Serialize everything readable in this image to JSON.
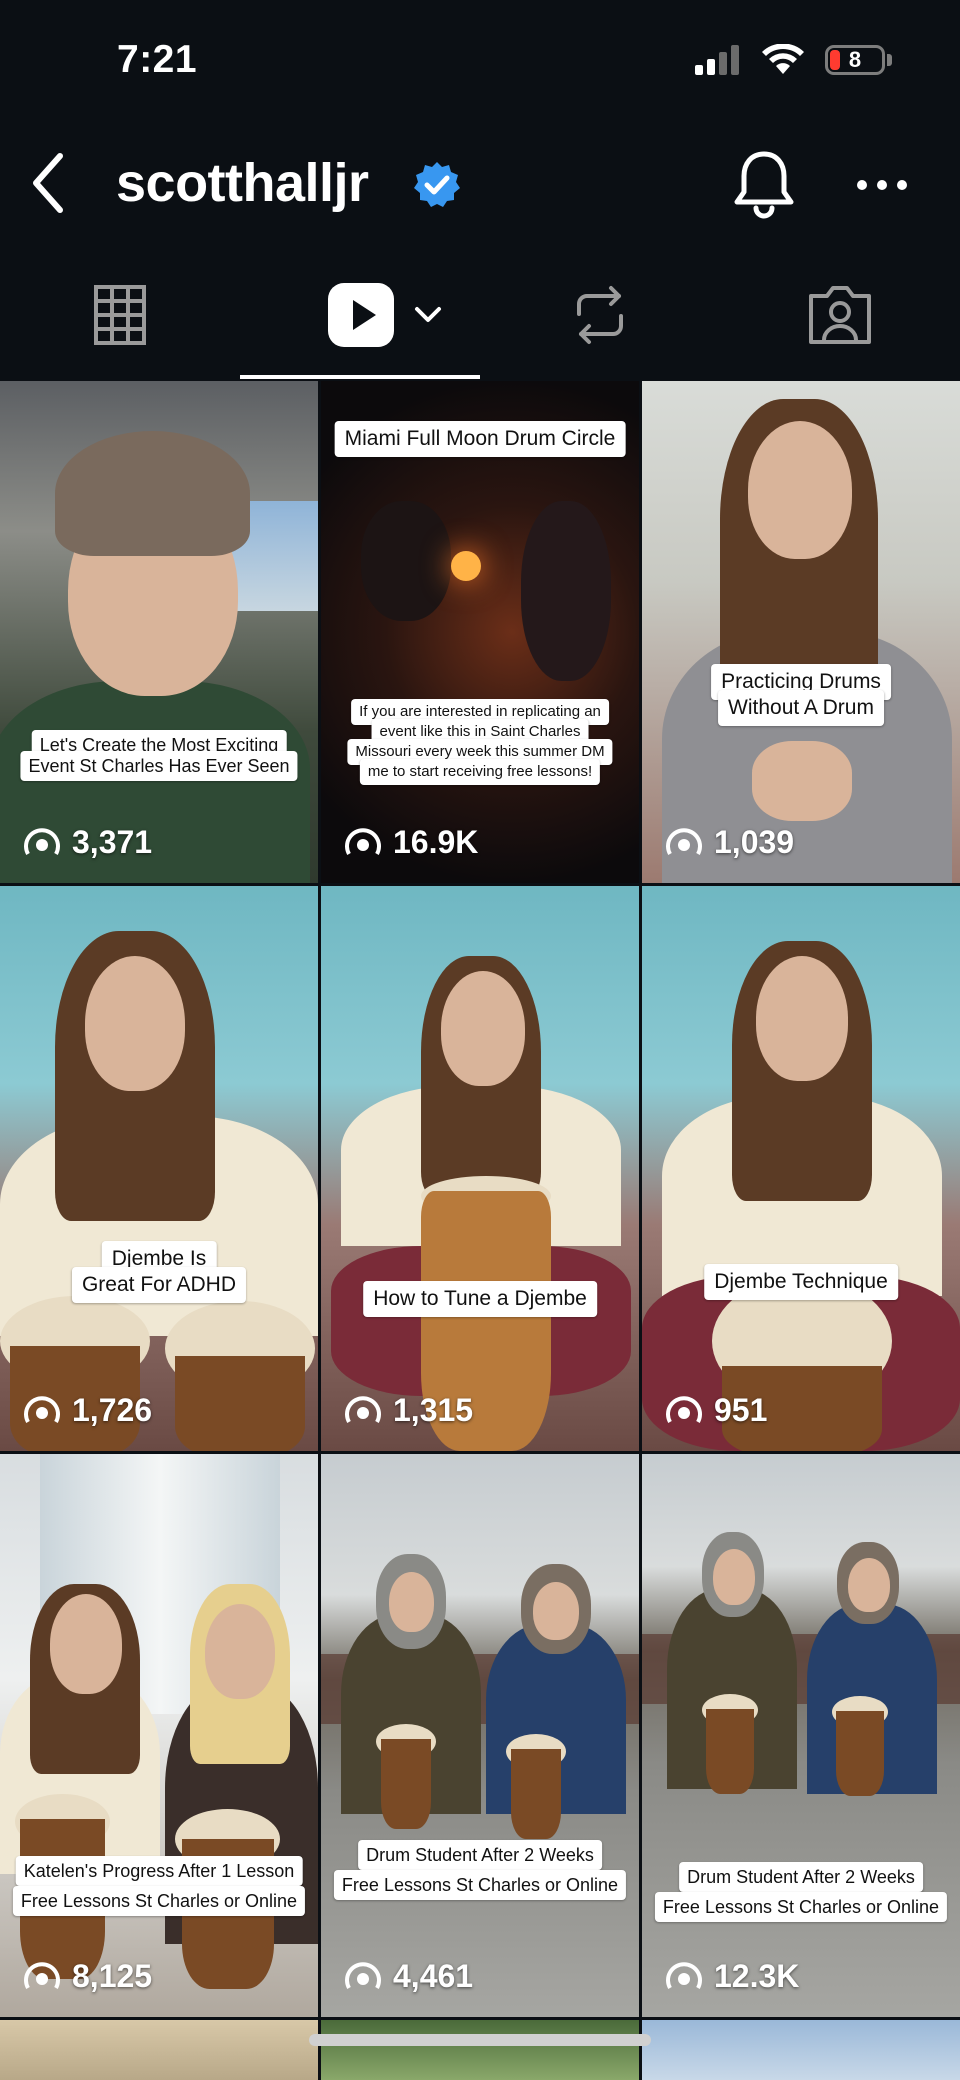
{
  "status_bar": {
    "time": "7:21",
    "battery_level": "8",
    "battery_color": "#ff3b30"
  },
  "header": {
    "username": "scotthalljr",
    "verified_color": "#3897f0",
    "back_icon": "chevron-left-icon",
    "bell_icon": "bell-icon",
    "more_icon": "ellipsis-icon"
  },
  "tabs": [
    {
      "name": "grid",
      "icon": "grid-icon",
      "active": false
    },
    {
      "name": "reels",
      "icon": "reels-play-icon",
      "active": true
    },
    {
      "name": "reposts",
      "icon": "repost-icon",
      "active": false
    },
    {
      "name": "tagged",
      "icon": "tagged-icon",
      "active": false
    }
  ],
  "posts": [
    {
      "views": "3,371",
      "captions": [
        "Let's Create the Most Exciting",
        "Event St Charles Has Ever Seen"
      ]
    },
    {
      "views": "16.9K",
      "captions": [
        "Miami Full Moon Drum Circle",
        "If you are interested in replicating an",
        "event like this in Saint Charles",
        "Missouri every week this summer DM",
        "me to start receiving free lessons!"
      ]
    },
    {
      "views": "1,039",
      "captions": [
        "Practicing Drums",
        "Without A Drum"
      ]
    },
    {
      "views": "1,726",
      "captions": [
        "Djembe Is",
        "Great For ADHD"
      ]
    },
    {
      "views": "1,315",
      "captions": [
        "How to Tune a Djembe"
      ]
    },
    {
      "views": "951",
      "captions": [
        "Djembe Technique"
      ]
    },
    {
      "views": "8,125",
      "captions": [
        "Katelen's Progress After 1 Lesson",
        "Free Lessons St Charles or Online"
      ]
    },
    {
      "views": "4,461",
      "captions": [
        "Drum Student After 2 Weeks",
        "Free Lessons St Charles or Online"
      ]
    },
    {
      "views": "12.3K",
      "captions": [
        "Drum Student After 2 Weeks",
        "Free Lessons St Charles or Online"
      ]
    }
  ]
}
